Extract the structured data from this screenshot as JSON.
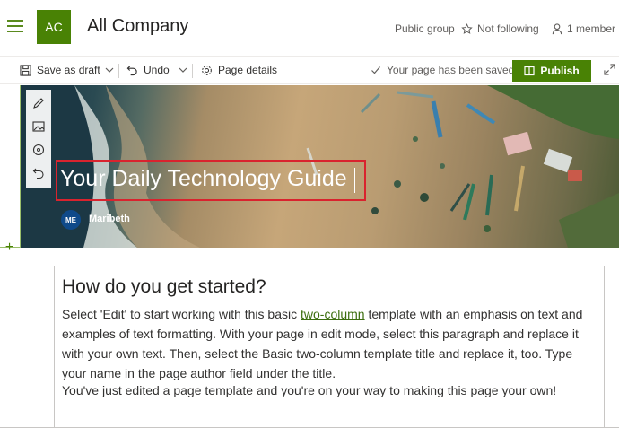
{
  "site": {
    "logo_initials": "AC",
    "title": "All Company",
    "group_type": "Public group",
    "follow_label": "Not following",
    "member_count": "1 member"
  },
  "toolbar": {
    "save_draft": "Save as draft",
    "undo": "Undo",
    "page_details": "Page details",
    "saved_status": "Your page has been saved",
    "publish": "Publish"
  },
  "hero": {
    "title": "Your Daily Technology Guide",
    "author_initials": "ME",
    "author_name": "Maribeth"
  },
  "content": {
    "heading": "How do you get started?",
    "p1_before": "Select 'Edit' to start working with this basic ",
    "p1_link": "two-column",
    "p1_after": " template with an emphasis on text and examples of text formatting. With your page in edit mode, select this paragraph and replace it with your own text. Then, select the Basic two-column template title and replace it, too. Type your name in the page author field under the title.",
    "p2": "You've just edited a page template and you're on your way to making this page your own!"
  },
  "colors": {
    "brand_green": "#498205",
    "highlight_red": "#d9232e"
  }
}
